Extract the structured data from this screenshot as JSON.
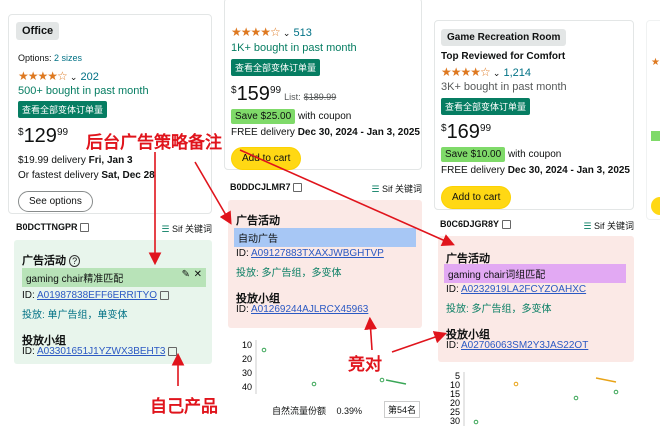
{
  "col1": {
    "category": "Office",
    "options_label": "Options:",
    "options_link": "2 sizes",
    "stars": "★★★★☆",
    "review_count": "202",
    "bought": "500+ bought in past month",
    "variants_badge": "查看全部变体订单量",
    "price_whole": "129",
    "price_frac": "99",
    "delivery_prefix": "$19.99 delivery",
    "delivery_date": "Fri, Jan 3",
    "fastest_prefix": "Or fastest delivery",
    "fastest_date": "Sat, Dec 28",
    "see_options": "See options",
    "asin": "B0DCTTNGPR",
    "sif": "Sif",
    "keyword_label": "关键词",
    "ad_activity_title": "广告活动",
    "campaign_name": "gaming chair精准匹配",
    "campaign_id_label": "ID:",
    "campaign_id": "A01987838EFF6ERRITYO",
    "placement": "投放: 单广告组，单变体",
    "ad_group_title": "投放小组",
    "ad_group_id_label": "ID:",
    "ad_group_id": "A03301651J1YZWX3BEHT3"
  },
  "col2": {
    "stars": "★★★★☆",
    "review_count": "513",
    "bought": "1K+ bought in past month",
    "variants_badge": "查看全部变体订单量",
    "price_whole": "159",
    "price_frac": "99",
    "list_label": "List:",
    "list_price": "$189.99",
    "save_badge": "Save $25.00",
    "with_coupon": "with coupon",
    "delivery_prefix": "FREE delivery",
    "delivery_date": "Dec 30, 2024 - Jan 3, 2025",
    "add_to_cart": "Add to cart",
    "asin": "B0DDCJLMR7",
    "sif": "Sif",
    "keyword_label": "关键词",
    "ad_activity_title": "广告活动",
    "campaign_name": "自动广告",
    "campaign_id_label": "ID:",
    "campaign_id": "A09127883TXAXJWBGHTVP",
    "placement": "投放: 多广告组，多变体",
    "ad_group_title": "投放小组",
    "ad_group_id_label": "ID:",
    "ad_group_id": "A01269244AJLRCX45963",
    "chart": {
      "y_ticks": [
        "10",
        "20",
        "30",
        "40"
      ],
      "footer_label": "自然流量份额",
      "footer_value": "0.39%",
      "footer_rank": "第54名"
    }
  },
  "col3": {
    "category": "Game Recreation Room",
    "top_reviewed": "Top Reviewed for Comfort",
    "stars": "★★★★☆",
    "review_count": "1,214",
    "bought": "3K+ bought in past month",
    "variants_badge": "查看全部变体订单量",
    "price_whole": "169",
    "price_frac": "99",
    "save_badge": "Save $10.00",
    "with_coupon": "with coupon",
    "delivery_prefix": "FREE delivery",
    "delivery_date": "Dec 30, 2024 - Jan 3, 2025",
    "add_to_cart": "Add to cart",
    "asin": "B0C6DJGR8Y",
    "sif": "Sif",
    "keyword_label": "关键词",
    "ad_activity_title": "广告活动",
    "campaign_name": "gaming chair词组匹配",
    "campaign_id_label": "ID:",
    "campaign_id": "A0232919LA2FCYZOAHXC",
    "placement": "投放: 多广告组，多变体",
    "ad_group_title": "投放小组",
    "ad_group_id_label": "ID:",
    "ad_group_id": "A02706063SM2Y3JAS22OT",
    "chart": {
      "y_ticks": [
        "5",
        "10",
        "15",
        "20",
        "25",
        "30"
      ]
    }
  },
  "annotations": {
    "strategy_note": "后台广告策略备注",
    "competitor": "竞对",
    "own_product": "自己产品"
  },
  "colors": {
    "annotation_red": "#e0141c",
    "amazon_green": "#067d62",
    "link_teal": "#007185",
    "button_yellow": "#ffd814"
  }
}
